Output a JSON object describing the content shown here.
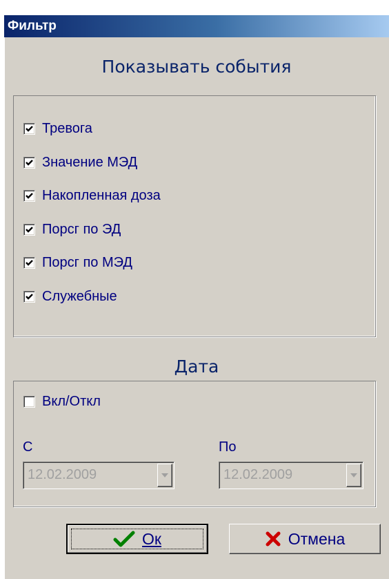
{
  "window": {
    "title": "Фильтр"
  },
  "events_section": {
    "title": "Показывать события",
    "items": [
      {
        "label": "Тревога",
        "checked": true
      },
      {
        "label": "Значение МЭД",
        "checked": true
      },
      {
        "label": "Накопленная доза",
        "checked": true
      },
      {
        "label": "Порсг по ЭД",
        "checked": true
      },
      {
        "label": "Порсг по МЭД",
        "checked": true
      },
      {
        "label": "Служебные",
        "checked": true
      }
    ]
  },
  "date_section": {
    "title": "Дата",
    "toggle": {
      "label": "Вкл/Откл",
      "checked": false
    },
    "from_label": "С",
    "to_label": "По",
    "from_value": "12.02.2009",
    "to_value": "12.02.2009"
  },
  "buttons": {
    "ok_label": "Ок",
    "cancel_label": "Отмена"
  },
  "colors": {
    "text": "#000080",
    "dialog_bg": "#d4d0c8",
    "ok_check": "#008000",
    "cancel_x": "#cc0000"
  },
  "icons": {
    "ok": "check-icon",
    "cancel": "x-icon",
    "dropdown": "chevron-down-icon"
  }
}
